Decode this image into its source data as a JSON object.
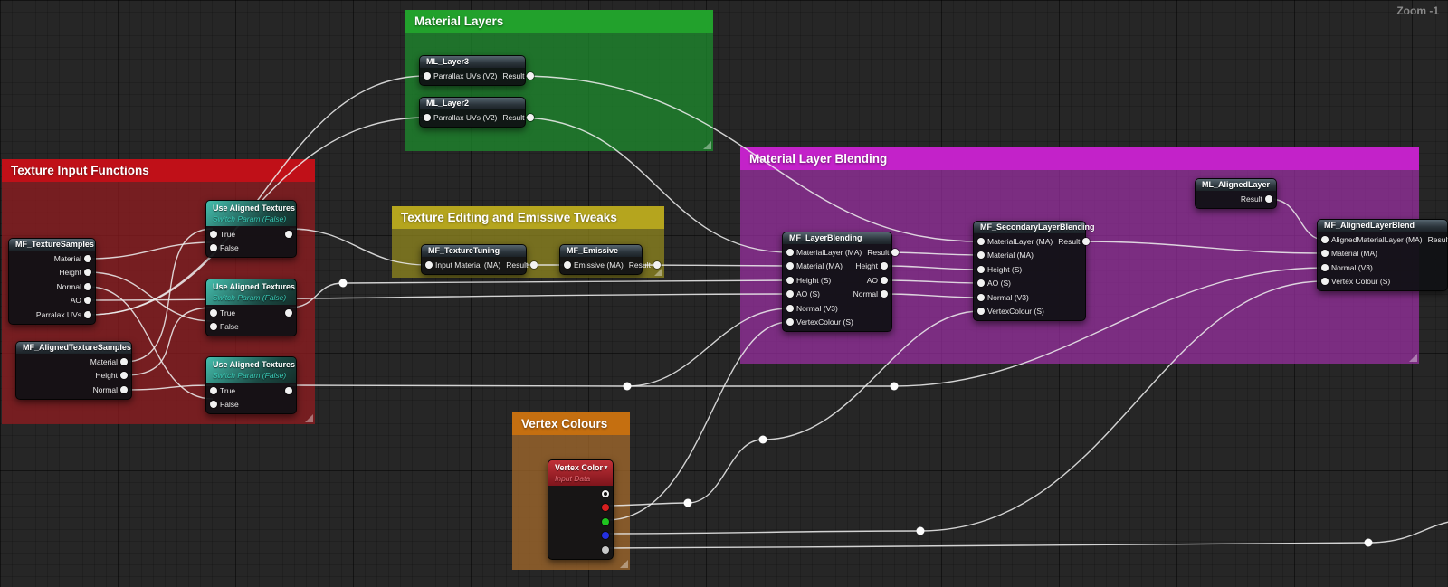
{
  "canvas": {
    "zoom_label": "Zoom -1"
  },
  "comments": {
    "material_layers": {
      "title": "Material Layers"
    },
    "texture_input": {
      "title": "Texture Input Functions"
    },
    "texture_editing": {
      "title": "Texture Editing and Emissive Tweaks"
    },
    "layer_blending": {
      "title": "Material Layer Blending"
    },
    "vertex_colours": {
      "title": "Vertex Colours"
    }
  },
  "nodes": {
    "ml3": {
      "title": "ML_Layer3",
      "rows": [
        {
          "in": "Parrallax UVs (V2)",
          "out": "Result"
        }
      ]
    },
    "ml2": {
      "title": "ML_Layer2",
      "rows": [
        {
          "in": "Parrallax UVs (V2)",
          "out": "Result"
        }
      ]
    },
    "ts": {
      "title": "MF_TextureSamples",
      "rows": [
        {
          "out": "Material"
        },
        {
          "out": "Height"
        },
        {
          "out": "Normal"
        },
        {
          "out": "AO"
        },
        {
          "out": "Parralax UVs"
        }
      ]
    },
    "ats": {
      "title": "MF_AlignedTextureSamples",
      "rows": [
        {
          "out": "Material"
        },
        {
          "out": "Height"
        },
        {
          "out": "Normal"
        }
      ]
    },
    "sw1": {
      "title": "Use Aligned Textures",
      "subtitle": "Switch Param (False)",
      "rows": [
        {
          "in": "True"
        },
        {
          "in": "False"
        }
      ]
    },
    "sw2": {
      "title": "Use Aligned Textures",
      "subtitle": "Switch Param (False)",
      "rows": [
        {
          "in": "True"
        },
        {
          "in": "False"
        }
      ]
    },
    "sw3": {
      "title": "Use Aligned Textures",
      "subtitle": "Switch Param (False)",
      "rows": [
        {
          "in": "True"
        },
        {
          "in": "False"
        }
      ]
    },
    "tt": {
      "title": "MF_TextureTuning",
      "rows": [
        {
          "in": "Input Material (MA)",
          "out": "Result"
        }
      ]
    },
    "em": {
      "title": "MF_Emissive",
      "rows": [
        {
          "in": "Emissive (MA)",
          "out": "Result"
        }
      ]
    },
    "lb": {
      "title": "MF_LayerBlending",
      "rows": [
        {
          "in": "MaterialLayer (MA)",
          "out": "Result"
        },
        {
          "in": "Material (MA)",
          "out": "Height"
        },
        {
          "in": "Height (S)",
          "out": "AO"
        },
        {
          "in": "AO (S)",
          "out": "Normal"
        },
        {
          "in": "Normal (V3)"
        },
        {
          "in": "VertexColour (S)"
        }
      ]
    },
    "slb": {
      "title": "MF_SecondaryLayerBlending",
      "rows": [
        {
          "in": "MaterialLayer (MA)",
          "out": "Result"
        },
        {
          "in": "Material (MA)"
        },
        {
          "in": "Height (S)"
        },
        {
          "in": "AO (S)"
        },
        {
          "in": "Normal (V3)"
        },
        {
          "in": "VertexColour (S)"
        }
      ]
    },
    "mlal": {
      "title": "ML_AlignedLayer",
      "rows": [
        {
          "out": "Result"
        }
      ]
    },
    "alb": {
      "title": "MF_AlignedLayerBlend",
      "rows": [
        {
          "in": "AlignedMaterialLayer (MA)",
          "out": "Result"
        },
        {
          "in": "Material (MA)"
        },
        {
          "in": "Normal (V3)"
        },
        {
          "in": "Vertex Colour (S)"
        }
      ]
    },
    "vc": {
      "title": "Vertex Color",
      "subtitle": "Input Data"
    }
  },
  "colors": {
    "background": "#262626",
    "comment_green_header": "#22a12c",
    "comment_red_header": "#c01018",
    "comment_yellow_header": "#b5a51e",
    "comment_magenta_header": "#c322c9",
    "comment_orange_header": "#c56f10",
    "switch_header_teal": "#45bfae",
    "switch_subtitle_teal": "#39cab6",
    "vertex_header_red": "#c03038",
    "vertex_subtitle_pink": "#e87079",
    "node_header_gray": "#56656f",
    "pin_white": "#f2f2f2",
    "pin_red": "#d81f1f",
    "pin_green": "#1fc41f",
    "pin_blue": "#2430e0",
    "pin_alpha": "#c8c8c8",
    "wire": "#ececec"
  }
}
